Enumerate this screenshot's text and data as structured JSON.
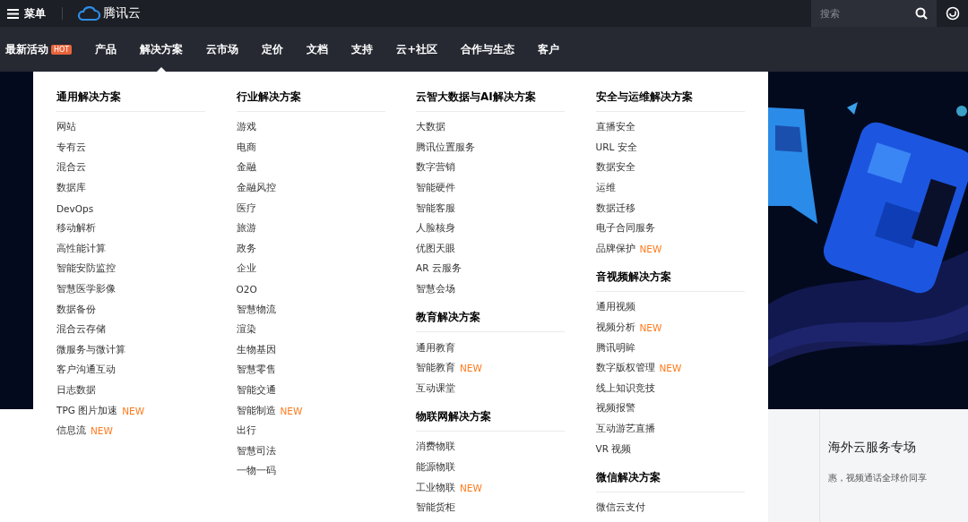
{
  "top_bar": {
    "menu_label": "菜单",
    "brand": "腾讯云",
    "search": {
      "placeholder": "搜索"
    }
  },
  "nav": [
    {
      "label": "最新活动",
      "badge": "HOT",
      "selected": false
    },
    {
      "label": "产品",
      "selected": false
    },
    {
      "label": "解决方案",
      "selected": true
    },
    {
      "label": "云市场",
      "selected": false
    },
    {
      "label": "定价",
      "selected": false
    },
    {
      "label": "文档",
      "selected": false
    },
    {
      "label": "支持",
      "selected": false
    },
    {
      "label": "云+社区",
      "selected": false
    },
    {
      "label": "合作与生态",
      "selected": false
    },
    {
      "label": "客户",
      "selected": false
    }
  ],
  "solutions_menu": {
    "columns": [
      [
        {
          "title": "通用解决方案",
          "items": [
            {
              "label": "网站"
            },
            {
              "label": "专有云"
            },
            {
              "label": "混合云"
            },
            {
              "label": "数据库"
            },
            {
              "label": "DevOps"
            },
            {
              "label": "移动解析"
            },
            {
              "label": "高性能计算"
            },
            {
              "label": "智能安防监控"
            },
            {
              "label": "智慧医学影像"
            },
            {
              "label": "数据备份"
            },
            {
              "label": "混合云存储"
            },
            {
              "label": "微服务与微计算"
            },
            {
              "label": "客户沟通互动"
            },
            {
              "label": "日志数据"
            },
            {
              "label": "TPG 图片加速",
              "tag": "NEW"
            },
            {
              "label": "信息流",
              "tag": "NEW"
            }
          ]
        }
      ],
      [
        {
          "title": "行业解决方案",
          "items": [
            {
              "label": "游戏"
            },
            {
              "label": "电商"
            },
            {
              "label": "金融"
            },
            {
              "label": "金融风控"
            },
            {
              "label": "医疗"
            },
            {
              "label": "旅游"
            },
            {
              "label": "政务"
            },
            {
              "label": "企业"
            },
            {
              "label": "O2O"
            },
            {
              "label": "智慧物流"
            },
            {
              "label": "渲染"
            },
            {
              "label": "生物基因"
            },
            {
              "label": "智慧零售"
            },
            {
              "label": "智能交通"
            },
            {
              "label": "智能制造",
              "tag": "NEW"
            },
            {
              "label": "出行"
            },
            {
              "label": "智慧司法"
            },
            {
              "label": "一物一码"
            }
          ]
        }
      ],
      [
        {
          "title": "云智大数据与AI解决方案",
          "items": [
            {
              "label": "大数据"
            },
            {
              "label": "腾讯位置服务"
            },
            {
              "label": "数字营销"
            },
            {
              "label": "智能硬件"
            },
            {
              "label": "智能客服"
            },
            {
              "label": "人脸核身"
            },
            {
              "label": "优图天眼"
            },
            {
              "label": "AR 云服务"
            },
            {
              "label": "智慧会场"
            }
          ]
        },
        {
          "title": "教育解决方案",
          "items": [
            {
              "label": "通用教育"
            },
            {
              "label": "智能教育",
              "tag": "NEW"
            },
            {
              "label": "互动课堂"
            }
          ]
        },
        {
          "title": "物联网解决方案",
          "items": [
            {
              "label": "消费物联"
            },
            {
              "label": "能源物联"
            },
            {
              "label": "工业物联",
              "tag": "NEW"
            },
            {
              "label": "智能货柜"
            }
          ]
        }
      ],
      [
        {
          "title": "安全与运维解决方案",
          "items": [
            {
              "label": "直播安全"
            },
            {
              "label": "URL 安全"
            },
            {
              "label": "数据安全"
            },
            {
              "label": "运维"
            },
            {
              "label": "数据迁移"
            },
            {
              "label": "电子合同服务"
            },
            {
              "label": "品牌保护",
              "tag": "NEW"
            }
          ]
        },
        {
          "title": "音视频解决方案",
          "items": [
            {
              "label": "通用视频"
            },
            {
              "label": "视频分析",
              "tag": "NEW"
            },
            {
              "label": "腾讯明眸"
            },
            {
              "label": "数字版权管理",
              "tag": "NEW"
            },
            {
              "label": "线上知识竞技"
            },
            {
              "label": "视频报警"
            },
            {
              "label": "互动游艺直播"
            },
            {
              "label": "VR 视频"
            }
          ]
        },
        {
          "title": "微信解决方案",
          "items": [
            {
              "label": "微信云支付"
            }
          ]
        }
      ]
    ]
  },
  "promo": {
    "title": "海外云服务专场",
    "text": "惠，视频通话全球价同享"
  }
}
